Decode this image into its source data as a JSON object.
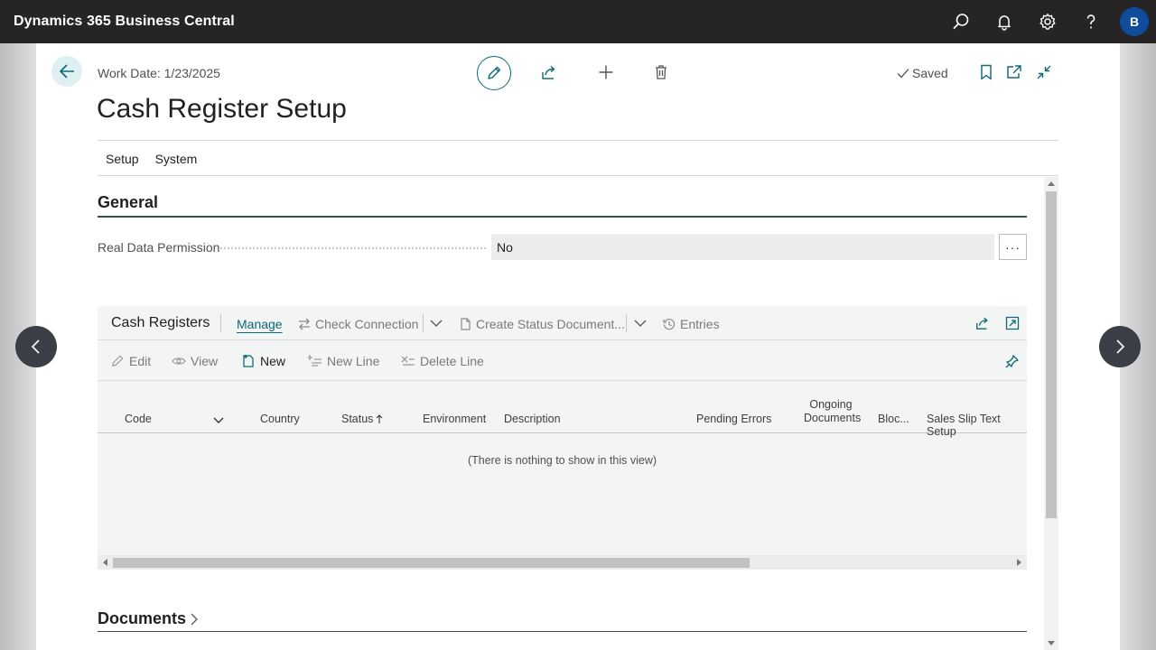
{
  "app": {
    "title": "Dynamics 365 Business Central",
    "avatar_initial": "B",
    "icons": [
      "search-icon",
      "bell-icon",
      "gear-icon",
      "help-icon"
    ]
  },
  "header": {
    "work_date": "Work Date: 1/23/2025",
    "title": "Cash Register Setup",
    "saved_label": "Saved"
  },
  "menu": {
    "items": [
      "Setup",
      "System"
    ]
  },
  "general": {
    "title": "General",
    "fields": [
      {
        "label": "Real Data Permission",
        "value": "No"
      }
    ],
    "ellipsis": "···"
  },
  "cash_registers": {
    "title": "Cash Registers",
    "actions": {
      "manage": "Manage",
      "check_connection": "Check Connection",
      "create_status": "Create Status Document...",
      "entries": "Entries"
    },
    "toolbar": {
      "edit": "Edit",
      "view": "View",
      "new": "New",
      "new_line": "New Line",
      "delete_line": "Delete Line"
    },
    "columns": {
      "code": "Code",
      "country": "Country",
      "status": "Status",
      "environment": "Environment",
      "description": "Description",
      "pending_errors": "Pending Errors",
      "ongoing_1": "Ongoing",
      "ongoing_2": "Documents",
      "blocked": "Bloc...",
      "sales_slip": "Sales Slip Text Setup"
    },
    "empty_message": "(There is nothing to show in this view)"
  },
  "documents": {
    "title": "Documents"
  },
  "colors": {
    "appbar": "#252525",
    "accent": "#0b6a74",
    "avatar": "#0f4c9b"
  }
}
